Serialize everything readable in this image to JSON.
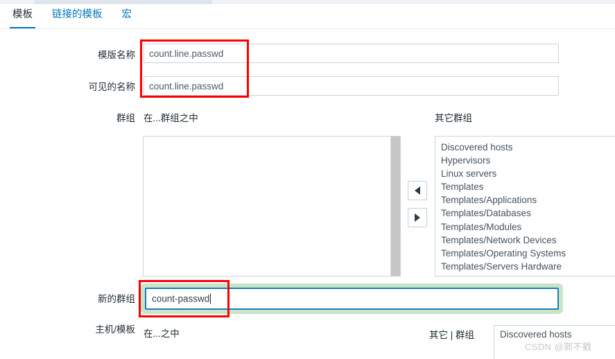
{
  "tabs": [
    {
      "label": "模板",
      "active": true
    },
    {
      "label": "链接的模板",
      "active": false
    },
    {
      "label": "宏",
      "active": false
    }
  ],
  "form": {
    "template_name": {
      "label": "模版名称",
      "value": "count.line.passwd",
      "placeholder": ""
    },
    "visible_name": {
      "label": "可见的名称",
      "value": "count.line.passwd",
      "placeholder": ""
    },
    "groups": {
      "label": "群组",
      "in_groups_header": "在...群组之中",
      "other_groups_header": "其它群组",
      "in_groups_items": [],
      "other_groups_items": [
        "Discovered hosts",
        "Hypervisors",
        "Linux servers",
        "Templates",
        "Templates/Applications",
        "Templates/Databases",
        "Templates/Modules",
        "Templates/Network Devices",
        "Templates/Operating Systems",
        "Templates/Servers Hardware"
      ],
      "move_left_icon": "triangle-left-icon",
      "move_right_icon": "triangle-right-icon"
    },
    "new_group": {
      "label": "新的群组",
      "value": "count-passwd",
      "placeholder": ""
    },
    "hosts_templates": {
      "label": "主机/模板",
      "in_header": "在...之中",
      "other_header": "其它 | 群组",
      "other_items": [
        "Discovered hosts"
      ]
    }
  },
  "watermark": "CSDN @郭不戳",
  "colors": {
    "accent": "#0275b8",
    "annotation": "#fb0000",
    "focus_border": "#1a7cb5",
    "focus_glow": "#c9e5c9"
  }
}
